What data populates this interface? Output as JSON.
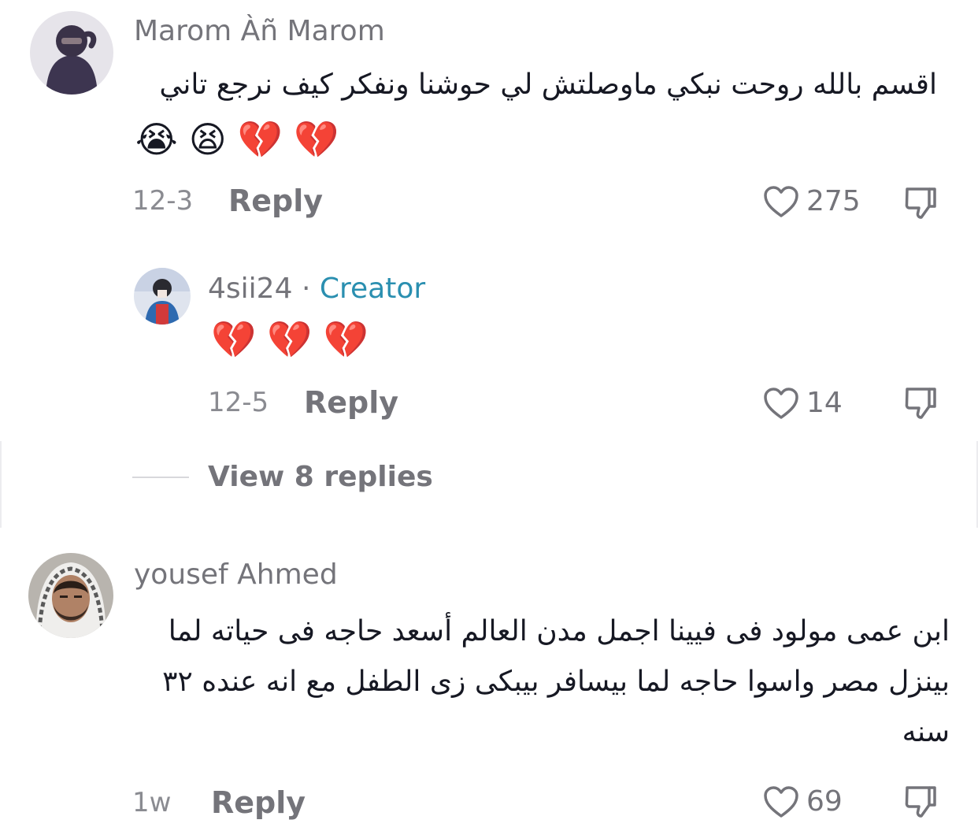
{
  "comments": [
    {
      "username": "Marom Àñ Marom",
      "text": "اقسم بالله روحت نبكي ماوصلتش لي حوشنا ونفكر كيف نرجع تاني",
      "emojis": [
        "😭",
        "😫",
        "💔",
        "💔"
      ],
      "date": "12-3",
      "reply_label": "Reply",
      "likes": "275"
    },
    {
      "username": "yousef Ahmed",
      "text": "ابن عمى مولود فى فيينا اجمل مدن العالم أسعد حاجه فى حياته لما بينزل مصر واسوا حاجه لما بيسافر بيبكى زى الطفل مع انه عنده ٣٢ سنه",
      "date": "1w",
      "reply_label": "Reply",
      "likes": "69"
    }
  ],
  "reply": {
    "username": "4sii24",
    "separator": "·",
    "creator_label": "Creator",
    "emojis": [
      "💔",
      "💔",
      "💔"
    ],
    "date": "12-5",
    "reply_label": "Reply",
    "likes": "14"
  },
  "view_replies_label": "View 8 replies",
  "colors": {
    "username": "#74747a",
    "creator": "#2a8fb0",
    "text": "#161823",
    "meta": "#8a8b91"
  },
  "icons": [
    "heart-outline-icon",
    "thumbs-down-icon"
  ]
}
